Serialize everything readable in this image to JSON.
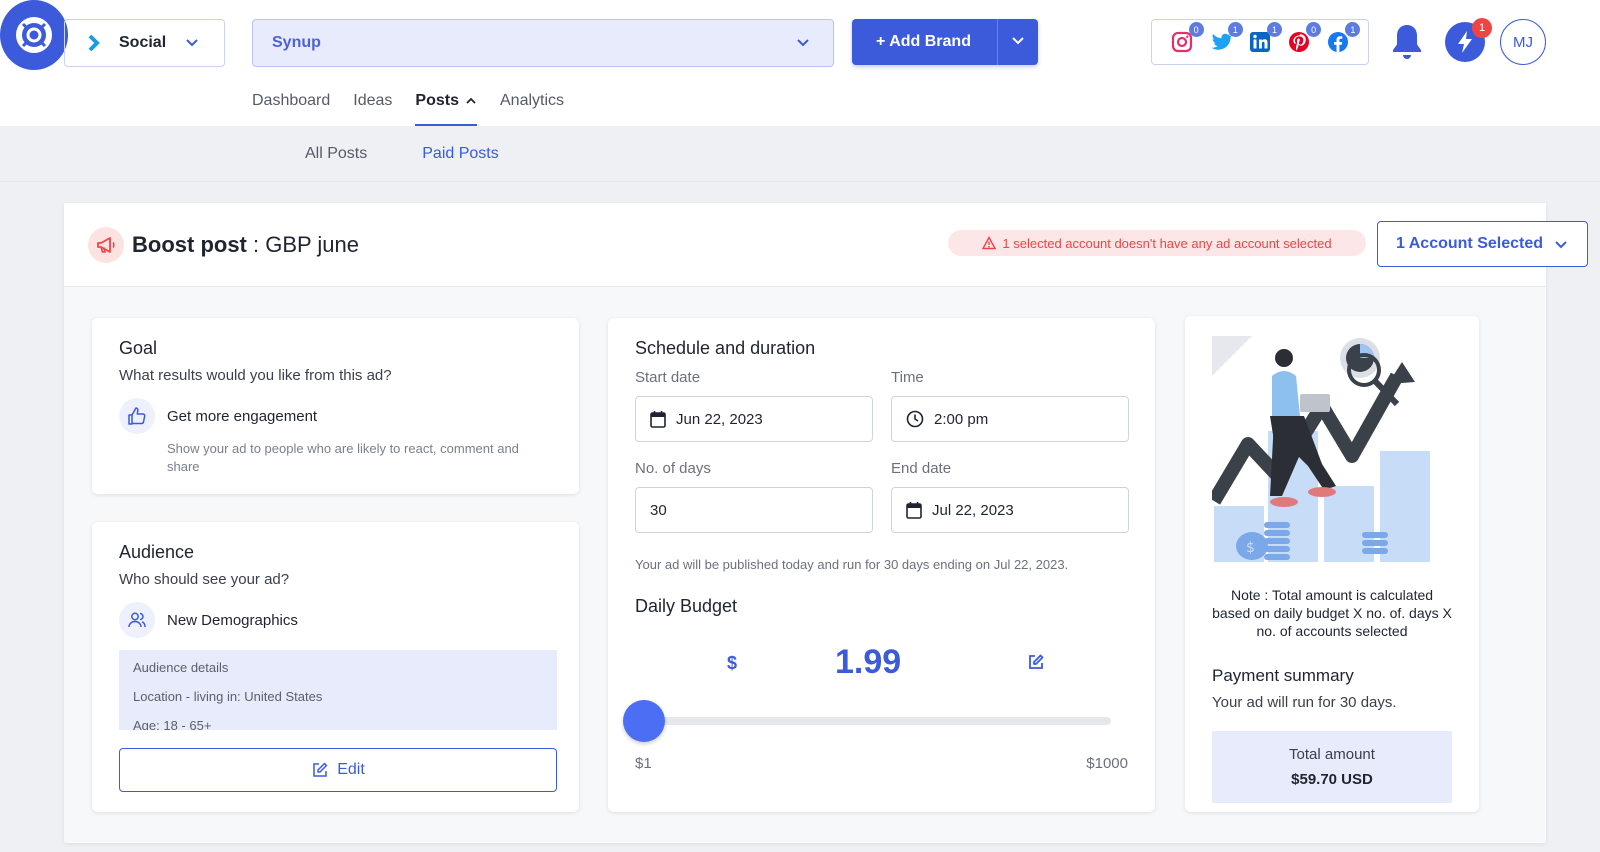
{
  "header": {
    "product_select": "Social",
    "brand_select": "Synup",
    "add_brand_label": "+ Add Brand",
    "social_counts": {
      "instagram": "0",
      "twitter": "1",
      "linkedin": "1",
      "pinterest": "0",
      "facebook": "1"
    },
    "notifications_count": "1",
    "avatar_initials": "MJ"
  },
  "main_nav": {
    "dashboard": "Dashboard",
    "ideas": "Ideas",
    "posts": "Posts",
    "analytics": "Analytics"
  },
  "sub_nav": {
    "all_posts": "All Posts",
    "paid_posts": "Paid Posts"
  },
  "boost": {
    "title_bold": "Boost post",
    "title_rest": " : GBP june",
    "warning": "1 selected account doesn't have any ad account selected",
    "account_select": "1 Account Selected"
  },
  "goal": {
    "title": "Goal",
    "question": "What results would you like from this ad?",
    "option_label": "Get more engagement",
    "option_desc": "Show your ad to people who are likely to react, comment and share"
  },
  "audience": {
    "title": "Audience",
    "question": "Who should see your ad?",
    "option_label": "New Demographics",
    "details_heading": "Audience details",
    "location": "Location - living in: United States",
    "age": "Age: 18 - 65+",
    "edit_label": "Edit"
  },
  "schedule": {
    "title": "Schedule and duration",
    "start_label": "Start date",
    "start_value": "Jun 22, 2023",
    "time_label": "Time",
    "time_value": "2:00 pm",
    "days_label": "No. of days",
    "days_value": "30",
    "end_label": "End date",
    "end_value": "Jul 22, 2023",
    "note": "Your ad will be published today and run for 30 days ending on Jul 22, 2023.",
    "budget_title": "Daily Budget",
    "currency": "$",
    "budget_value": "1.99",
    "slider_fraction": 0.001,
    "min_label": "$1",
    "max_label": "$1000"
  },
  "payment": {
    "note": "Note : Total amount is calculated based on daily budget X no. of. days X no. of accounts selected",
    "title": "Payment summary",
    "subtitle": "Your ad will run for 30 days.",
    "total_label": "Total amount",
    "total_value": "$59.70 USD"
  },
  "colors": {
    "accent": "#3b5bdb",
    "warning": "#ef4444"
  }
}
